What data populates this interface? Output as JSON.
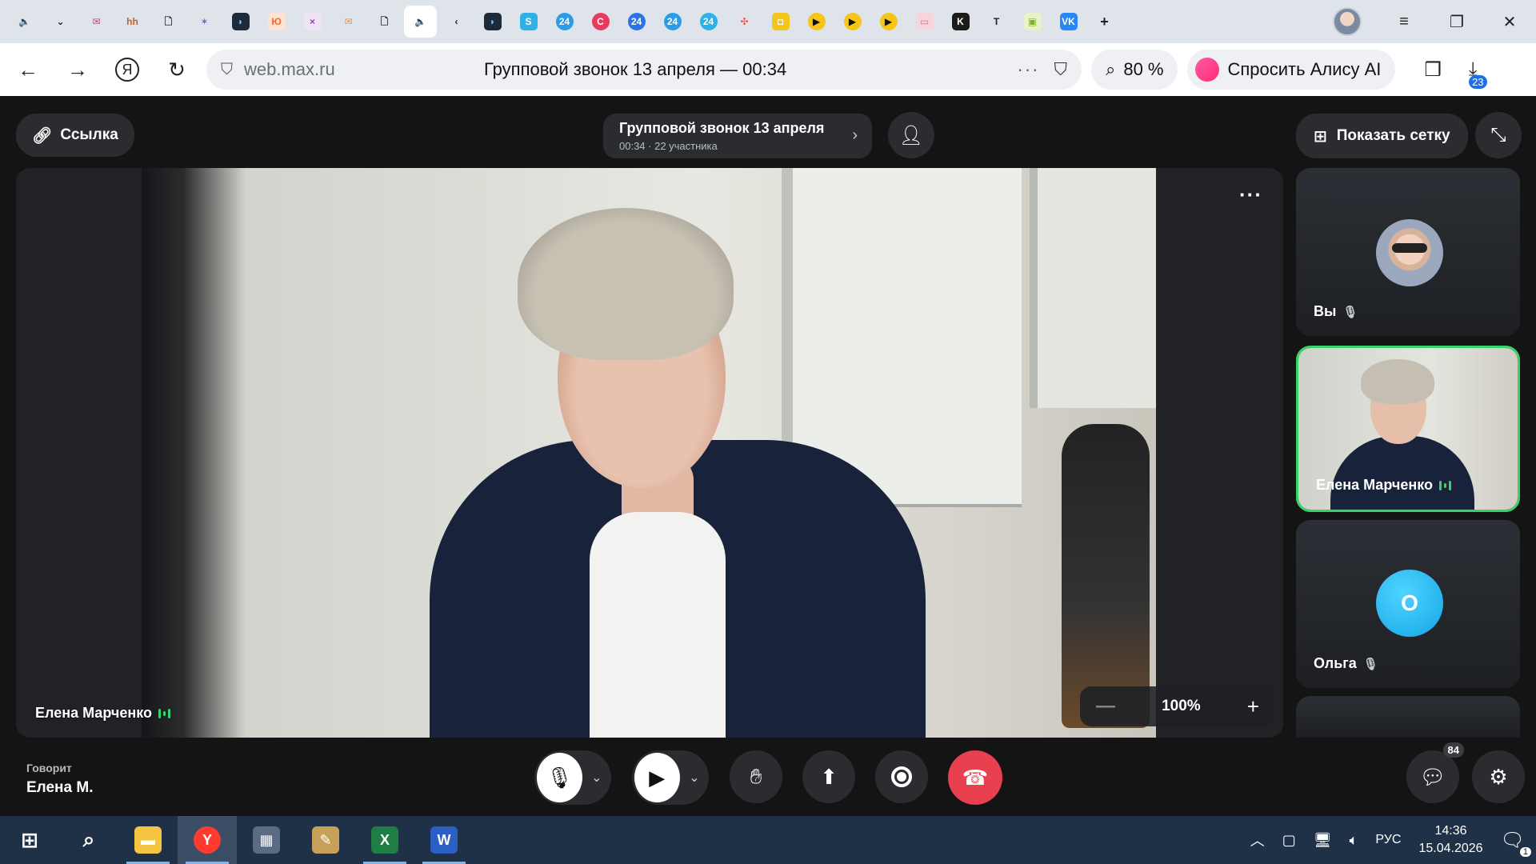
{
  "browser": {
    "tabs": [
      {
        "name": "tab-sound",
        "glyph": "🔈",
        "bg": "#dfe3ea",
        "fg": "#222",
        "active": true
      },
      {
        "name": "tab-dropdown",
        "glyph": "⌄",
        "bg": "transparent",
        "fg": "#222"
      },
      {
        "name": "tab-mail",
        "glyph": "✉",
        "bg": "transparent",
        "fg": "#e6336b"
      },
      {
        "name": "tab-hh",
        "glyph": "hh",
        "bg": "transparent",
        "fg": "#c0622a"
      },
      {
        "name": "tab-doc",
        "glyph": "🗋",
        "bg": "transparent",
        "fg": "#222"
      },
      {
        "name": "tab-star",
        "glyph": "✶",
        "bg": "transparent",
        "fg": "#7b5ae0"
      },
      {
        "name": "tab-app-1",
        "glyph": "◗",
        "bg": "#1c2a3c",
        "fg": "#7ac0ff"
      },
      {
        "name": "tab-orange",
        "glyph": "Ю",
        "bg": "#ffe3d2",
        "fg": "#f26a2e"
      },
      {
        "name": "tab-purple",
        "glyph": "×",
        "bg": "#efe3f5",
        "fg": "#9b3eb5"
      },
      {
        "name": "tab-envelope",
        "glyph": "✉",
        "bg": "transparent",
        "fg": "#f2922e"
      },
      {
        "name": "tab-doc-2",
        "glyph": "🗋",
        "bg": "transparent",
        "fg": "#222"
      },
      {
        "name": "tab-active-sound",
        "glyph": "🔈",
        "bg": "#ffffff",
        "fg": "#222",
        "active": true
      },
      {
        "name": "tab-back",
        "glyph": "‹",
        "bg": "transparent",
        "fg": "#222"
      },
      {
        "name": "tab-app-2",
        "glyph": "◗",
        "bg": "#1c2a3c",
        "fg": "#7ac0ff"
      },
      {
        "name": "tab-skype",
        "glyph": "S",
        "bg": "#2fb1e6",
        "fg": "#fff"
      },
      {
        "name": "tab-24-a",
        "glyph": "24",
        "bg": "#2b9de8",
        "fg": "#fff",
        "round": true
      },
      {
        "name": "tab-red",
        "glyph": "C",
        "bg": "#e83a5f",
        "fg": "#fff",
        "round": true
      },
      {
        "name": "tab-24-b",
        "glyph": "24",
        "bg": "#2b74e8",
        "fg": "#fff",
        "round": true
      },
      {
        "name": "tab-24-c",
        "glyph": "24",
        "bg": "#2b9de8",
        "fg": "#fff",
        "round": true
      },
      {
        "name": "tab-24-d",
        "glyph": "24",
        "bg": "#2bb2e8",
        "fg": "#fff",
        "round": true
      },
      {
        "name": "tab-pinwheel",
        "glyph": "✣",
        "bg": "transparent",
        "fg": "#e8503a"
      },
      {
        "name": "tab-yellow",
        "glyph": "◘",
        "bg": "#f5c518",
        "fg": "#fff"
      },
      {
        "name": "tab-play-1",
        "glyph": "▶",
        "bg": "#f5c518",
        "fg": "#111",
        "round": true
      },
      {
        "name": "tab-play-2",
        "glyph": "▶",
        "bg": "#f5c518",
        "fg": "#111",
        "round": true
      },
      {
        "name": "tab-play-3",
        "glyph": "▶",
        "bg": "#f5c518",
        "fg": "#111",
        "round": true
      },
      {
        "name": "tab-pink",
        "glyph": "▭",
        "bg": "#f7d5dd",
        "fg": "#e46a85"
      },
      {
        "name": "tab-k",
        "glyph": "K",
        "bg": "#1b1b1b",
        "fg": "#fff"
      },
      {
        "name": "tab-t",
        "glyph": "T",
        "bg": "transparent",
        "fg": "#222",
        "round": true
      },
      {
        "name": "tab-green",
        "glyph": "▣",
        "bg": "#e8f4c8",
        "fg": "#7cb32a"
      },
      {
        "name": "tab-vk",
        "glyph": "VK",
        "bg": "#2787f5",
        "fg": "#fff"
      }
    ],
    "new_tab": "+",
    "menu": "≡",
    "restore": "❐",
    "close": "✕",
    "back": "←",
    "forward": "→",
    "yandex": "Я",
    "reload": "↻",
    "shield": "⛉",
    "domain": "web.max.ru",
    "page_title": "Групповой звонок 13 апреля — 00:34",
    "more": "···",
    "bookmark": "⛉",
    "zoom_glyph": "⌕",
    "zoom": "80 %",
    "alice": "Спросить Алису AI",
    "downloads_badge": "23"
  },
  "call": {
    "link_label": "Ссылка",
    "title": "Групповой звонок 13 апреля",
    "subtitle": "00:34 · 22 участника",
    "grid_label": "Показать сетку",
    "main_speaker": "Елена Марченко",
    "zoom_value": "100%",
    "minus": "—",
    "plus": "+",
    "participants": [
      {
        "name": "Вы",
        "muted": true
      },
      {
        "name": "Елена Марченко",
        "speaking": true
      },
      {
        "name": "Ольга",
        "initial": "О",
        "muted": true
      }
    ],
    "speaking_label": "Говорит",
    "speaking_name": "Елена М.",
    "chat_badge": "84",
    "colors": {
      "accent_green": "#36d36b",
      "end_call": "#e8404f",
      "avatar_blue": "#14a6e6",
      "panel": "#2a2c30"
    }
  },
  "taskbar": {
    "lang": "РУС",
    "time": "14:36",
    "date": "15.04.2026",
    "notifications": "1",
    "apps": [
      {
        "name": "start-button",
        "glyph": "⊞",
        "bg": "transparent"
      },
      {
        "name": "search-button",
        "glyph": "⌕",
        "bg": "transparent"
      },
      {
        "name": "explorer-app",
        "glyph": "▬",
        "bg": "#f5c542",
        "open": true
      },
      {
        "name": "yandex-browser-app",
        "glyph": "Y",
        "bg": "#ff3b30",
        "active": true
      },
      {
        "name": "calculator-app",
        "glyph": "▦",
        "bg": "#5a6c84"
      },
      {
        "name": "paint-app",
        "glyph": "✎",
        "bg": "#c7a15a"
      },
      {
        "name": "excel-app",
        "glyph": "X",
        "bg": "#1e7e45",
        "open": true
      },
      {
        "name": "word-app",
        "glyph": "W",
        "bg": "#2b5fc4",
        "open": true
      }
    ]
  }
}
